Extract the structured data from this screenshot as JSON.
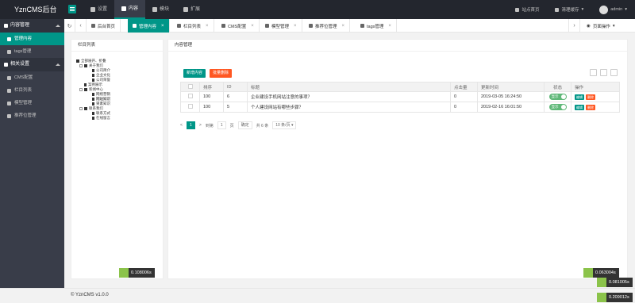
{
  "app": {
    "title": "YznCMS后台"
  },
  "topnav": [
    {
      "label": "设置",
      "icon": "gear-icon",
      "active": false
    },
    {
      "label": "内容",
      "icon": "file-icon",
      "active": true
    },
    {
      "label": "模块",
      "icon": "grid-icon",
      "active": false
    },
    {
      "label": "扩展",
      "icon": "puzzle-icon",
      "active": false
    }
  ],
  "header_right": {
    "site_home": "站点首页",
    "clear_cache": "清理缓存",
    "user": "admin"
  },
  "sidebar": {
    "group1": "内容管理",
    "group1_items": [
      {
        "label": "管理内容",
        "active": true
      },
      {
        "label": "tags管理",
        "active": false
      }
    ],
    "group2": "相关设置",
    "group2_items": [
      {
        "label": "CMS配置"
      },
      {
        "label": "栏目列表"
      },
      {
        "label": "模型管理"
      },
      {
        "label": "推荐位管理"
      }
    ]
  },
  "tabs": [
    {
      "label": "后台首页",
      "icon": "home-icon",
      "closable": false,
      "active": false
    },
    {
      "label": "管理内容",
      "icon": "file-icon",
      "closable": true,
      "active": true
    },
    {
      "label": "栏目列表",
      "icon": "list-icon",
      "closable": true,
      "active": false
    },
    {
      "label": "CMS配置",
      "icon": "gear-icon",
      "closable": true,
      "active": false
    },
    {
      "label": "模型管理",
      "icon": "model-icon",
      "closable": true,
      "active": false
    },
    {
      "label": "推荐位管理",
      "icon": "bookmark-icon",
      "closable": true,
      "active": false
    },
    {
      "label": "tags管理",
      "icon": "tag-icon",
      "closable": true,
      "active": false
    }
  ],
  "page_ops": "页面操作",
  "left_panel": {
    "title": "栏目列表",
    "tree": [
      {
        "label": "全部展开、折叠",
        "level": 0,
        "kind": "folder"
      },
      {
        "label": "关于我们",
        "level": 1,
        "kind": "folder"
      },
      {
        "label": "公司简介",
        "level": 2,
        "kind": "doc"
      },
      {
        "label": "企业文化",
        "level": 2,
        "kind": "doc"
      },
      {
        "label": "公司荣誉",
        "level": 2,
        "kind": "doc"
      },
      {
        "label": "案例展示",
        "level": 1,
        "kind": "doc"
      },
      {
        "label": "新闻中心",
        "level": 1,
        "kind": "folder"
      },
      {
        "label": "网络营销",
        "level": 2,
        "kind": "doc"
      },
      {
        "label": "网站知识",
        "level": 2,
        "kind": "doc",
        "selected": true
      },
      {
        "label": "果素知识",
        "level": 2,
        "kind": "doc"
      },
      {
        "label": "联系我们",
        "level": 1,
        "kind": "folder"
      },
      {
        "label": "联系方式",
        "level": 2,
        "kind": "doc"
      },
      {
        "label": "在线留言",
        "level": 2,
        "kind": "doc"
      }
    ],
    "timer": "0.108006s"
  },
  "right_panel": {
    "title": "内容管理",
    "add_button": "新增内容",
    "batch_delete_button": "批量删除",
    "columns": [
      "",
      "排序",
      "ID",
      "标题",
      "点击量",
      "更新时间",
      "状态",
      "操作"
    ],
    "rows": [
      {
        "sort": "100",
        "id": "6",
        "title": "企业建设手机网站注意的事项？",
        "hits": "0",
        "updated": "2019-03-05 16:24:50",
        "status": "显示",
        "edit": "编辑",
        "del": "删除"
      },
      {
        "sort": "100",
        "id": "5",
        "title": "个人建设网站有哪些步骤？",
        "hits": "0",
        "updated": "2019-02-16 16:01:50",
        "status": "显示",
        "edit": "编辑",
        "del": "删除"
      }
    ],
    "pager": {
      "prev": "<",
      "current": "1",
      "next": ">",
      "goto": "到第",
      "page_input": "1",
      "page_unit": "页",
      "confirm": "确定",
      "total": "共 6 条",
      "per_page": "10 条/页"
    },
    "timer": "0.063004s"
  },
  "extra_timers": [
    "0.081005s",
    "0.209012s"
  ],
  "footer": "© YznCMS v1.0.0",
  "colors": {
    "accent": "#009688",
    "danger": "#ff5722",
    "sidebar": "#393d49",
    "header": "#23262e"
  }
}
